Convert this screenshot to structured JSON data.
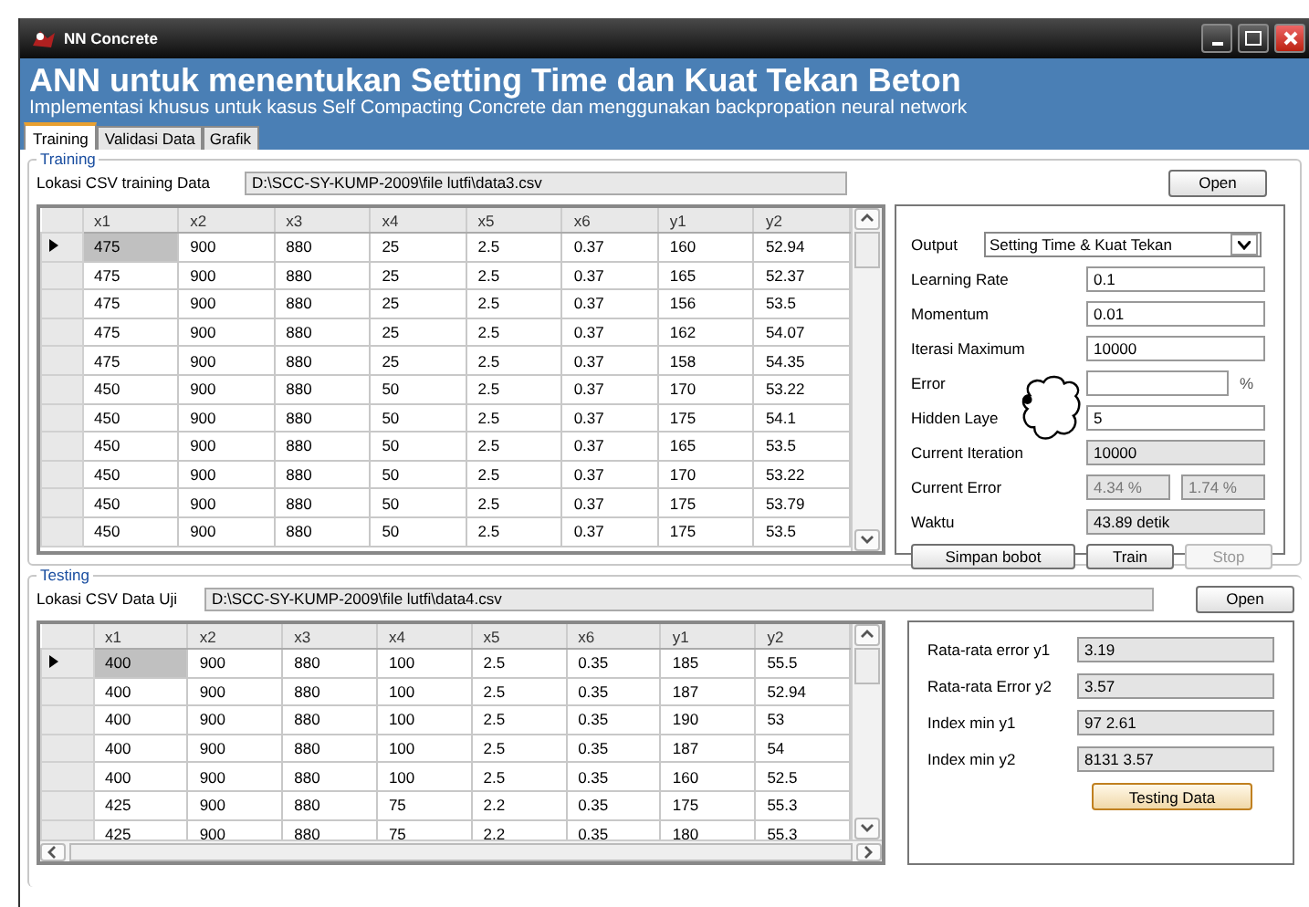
{
  "window": {
    "title": "NN Concrete"
  },
  "header": {
    "title": "ANN untuk menentukan Setting Time dan Kuat Tekan Beton",
    "subtitle": "Implementasi khusus untuk kasus Self Compacting Concrete dan menggunakan backpropation neural network"
  },
  "tabs": [
    {
      "label": "Training",
      "selected": true
    },
    {
      "label": "Validasi Data",
      "selected": false
    },
    {
      "label": "Grafik",
      "selected": false
    }
  ],
  "training": {
    "group_title": "Training",
    "path_label": "Lokasi CSV training Data",
    "path_value": "D:\\SCC-SY-KUMP-2009\\file lutfi\\data3.csv",
    "open_button": "Open",
    "grid": {
      "columns": [
        "x1",
        "x2",
        "x3",
        "x4",
        "x5",
        "x6",
        "y1",
        "y2"
      ],
      "rows": [
        {
          "selected": true,
          "cells": [
            "475",
            "900",
            "880",
            "25",
            "2.5",
            "0.37",
            "160",
            "52.94"
          ]
        },
        {
          "selected": false,
          "cells": [
            "475",
            "900",
            "880",
            "25",
            "2.5",
            "0.37",
            "165",
            "52.37"
          ]
        },
        {
          "selected": false,
          "cells": [
            "475",
            "900",
            "880",
            "25",
            "2.5",
            "0.37",
            "156",
            "53.5"
          ]
        },
        {
          "selected": false,
          "cells": [
            "475",
            "900",
            "880",
            "25",
            "2.5",
            "0.37",
            "162",
            "54.07"
          ]
        },
        {
          "selected": false,
          "cells": [
            "475",
            "900",
            "880",
            "25",
            "2.5",
            "0.37",
            "158",
            "54.35"
          ]
        },
        {
          "selected": false,
          "cells": [
            "450",
            "900",
            "880",
            "50",
            "2.5",
            "0.37",
            "170",
            "53.22"
          ]
        },
        {
          "selected": false,
          "cells": [
            "450",
            "900",
            "880",
            "50",
            "2.5",
            "0.37",
            "175",
            "54.1"
          ]
        },
        {
          "selected": false,
          "cells": [
            "450",
            "900",
            "880",
            "50",
            "2.5",
            "0.37",
            "165",
            "53.5"
          ]
        },
        {
          "selected": false,
          "cells": [
            "450",
            "900",
            "880",
            "50",
            "2.5",
            "0.37",
            "170",
            "53.22"
          ]
        },
        {
          "selected": false,
          "cells": [
            "450",
            "900",
            "880",
            "50",
            "2.5",
            "0.37",
            "175",
            "53.79"
          ]
        },
        {
          "selected": false,
          "cells": [
            "450",
            "900",
            "880",
            "50",
            "2.5",
            "0.37",
            "175",
            "53.5"
          ]
        }
      ]
    },
    "panel": {
      "output_label": "Output",
      "output_value": "Setting Time & Kuat Tekan",
      "fields": [
        {
          "label": "Learning Rate",
          "values": [
            "0.1"
          ],
          "readonly": false
        },
        {
          "label": "Momentum",
          "values": [
            "0.01"
          ],
          "readonly": false
        },
        {
          "label": "Iterasi Maximum",
          "values": [
            "10000"
          ],
          "readonly": false
        },
        {
          "label": "Error",
          "unit": "%",
          "readonly": false
        },
        {
          "label": "Hidden Laye",
          "values": [
            "5"
          ],
          "readonly": false
        },
        {
          "label": "Current Iteration",
          "values": [
            "10000"
          ],
          "readonly": true
        },
        {
          "label": "Current Error",
          "values": [
            "4.34 %",
            "1.74 %"
          ],
          "readonly": true
        },
        {
          "label": "Waktu",
          "values": [
            "43.89 detik"
          ],
          "readonly": true
        }
      ],
      "buttons": [
        {
          "label": "Simpan bobot",
          "disabled": false
        },
        {
          "label": "Train",
          "disabled": false
        },
        {
          "label": "Stop",
          "disabled": true
        }
      ]
    }
  },
  "testing": {
    "group_title": "Testing",
    "path_label": "Lokasi CSV Data Uji",
    "path_value": "D:\\SCC-SY-KUMP-2009\\file lutfi\\data4.csv",
    "open_button": "Open",
    "grid": {
      "columns": [
        "x1",
        "x2",
        "x3",
        "x4",
        "x5",
        "x6",
        "y1",
        "y2"
      ],
      "rows": [
        {
          "selected": true,
          "cells": [
            "400",
            "900",
            "880",
            "100",
            "2.5",
            "0.35",
            "185",
            "55.5"
          ]
        },
        {
          "selected": false,
          "cells": [
            "400",
            "900",
            "880",
            "100",
            "2.5",
            "0.35",
            "187",
            "52.94"
          ]
        },
        {
          "selected": false,
          "cells": [
            "400",
            "900",
            "880",
            "100",
            "2.5",
            "0.35",
            "190",
            "53"
          ]
        },
        {
          "selected": false,
          "cells": [
            "400",
            "900",
            "880",
            "100",
            "2.5",
            "0.35",
            "187",
            "54"
          ]
        },
        {
          "selected": false,
          "cells": [
            "400",
            "900",
            "880",
            "100",
            "2.5",
            "0.35",
            "160",
            "52.5"
          ]
        },
        {
          "selected": false,
          "cells": [
            "425",
            "900",
            "880",
            "75",
            "2.2",
            "0.35",
            "175",
            "55.3"
          ]
        },
        {
          "selected": false,
          "cells": [
            "425",
            "900",
            "880",
            "75",
            "2.2",
            "0.35",
            "180",
            "55.3"
          ]
        }
      ]
    },
    "stats": [
      {
        "label": "Rata-rata error y1",
        "value": "3.19"
      },
      {
        "label": "Rata-rata Error y2",
        "value": "3.57"
      },
      {
        "label": "Index min y1",
        "value": "97 2.61"
      },
      {
        "label": "Index min y2",
        "value": "8131 3.57"
      }
    ],
    "button": "Testing Data"
  }
}
